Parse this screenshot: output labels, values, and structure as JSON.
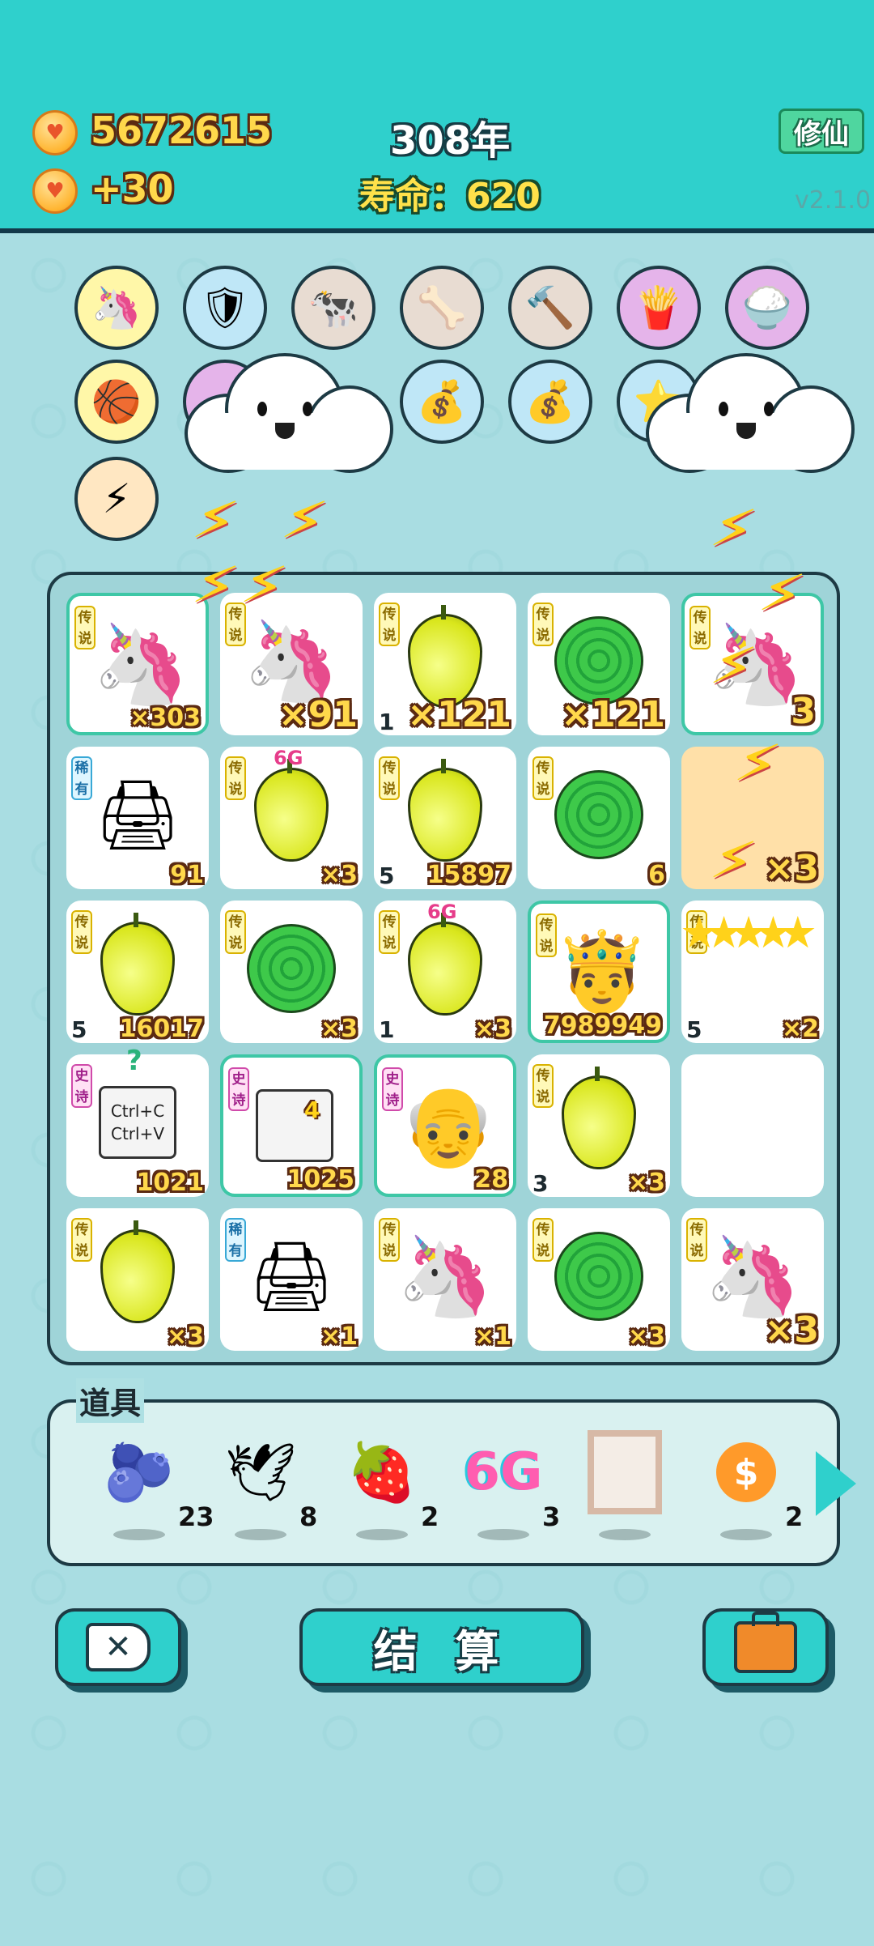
{
  "header": {
    "coins": "5672615",
    "income": "+30",
    "year": "308年",
    "lifespan_label": "寿命：",
    "lifespan_value": "620",
    "xiuxian_button": "修仙",
    "version": "v2.1.0"
  },
  "round_items": [
    {
      "name": "unicorn-icon",
      "glyph": "🦄",
      "bg": "#fff7a8"
    },
    {
      "name": "shield-wrench-icon",
      "glyph": "🛡",
      "bg": "#bfe7f7"
    },
    {
      "name": "cow-pair-icon",
      "glyph": "🐄",
      "bg": "#e8dcd2"
    },
    {
      "name": "pet-bowl-icon",
      "glyph": "🦴",
      "bg": "#e8dcd2"
    },
    {
      "name": "hammer-icon",
      "glyph": "🔨",
      "bg": "#e8dcd2"
    },
    {
      "name": "fries-icon",
      "glyph": "🍟",
      "bg": "#e5b4ea"
    },
    {
      "name": "rice-bowl-icon",
      "glyph": "🍚",
      "bg": "#e5b4ea"
    },
    {
      "name": "basketballs-icon",
      "glyph": "🏀",
      "bg": "#fff7a8"
    },
    {
      "name": "hidden-item-icon",
      "glyph": "",
      "bg": "#e5b4ea"
    },
    {
      "name": "money-bag-icon",
      "glyph": "💰",
      "bg": "#bfe7f7"
    },
    {
      "name": "money-bag-icon",
      "glyph": "💰",
      "bg": "#bfe7f7"
    },
    {
      "name": "star-wand-icon",
      "glyph": "⭐",
      "bg": "#bfe7f7"
    },
    {
      "name": "lightning-icon",
      "glyph": "⚡",
      "bg": "#ffe7c2"
    }
  ],
  "grid": [
    {
      "badge": "传说",
      "type": "legend",
      "icon": "unicorn",
      "count": "×303",
      "big": false,
      "hl": true
    },
    {
      "badge": "传说",
      "type": "legend",
      "icon": "unicorn",
      "count": "×91",
      "big": true
    },
    {
      "badge": "传说",
      "type": "legend",
      "icon": "pear",
      "count": "×121",
      "big": true,
      "lvl": "1"
    },
    {
      "badge": "传说",
      "type": "legend",
      "icon": "melon",
      "count": "×121",
      "big": true
    },
    {
      "badge": "传说",
      "type": "legend",
      "icon": "unicorn",
      "count": "3",
      "big": true,
      "hl": true
    },
    {
      "badge": "稀有",
      "type": "rare",
      "icon": "printer",
      "count": "91"
    },
    {
      "badge": "传说",
      "type": "legend",
      "icon": "pear",
      "count": "×3",
      "sixg": "6G"
    },
    {
      "badge": "传说",
      "type": "legend",
      "icon": "pear",
      "count": "15897",
      "lvl": "5"
    },
    {
      "badge": "传说",
      "type": "legend",
      "icon": "melon",
      "count": "6"
    },
    {
      "badge": "",
      "type": "",
      "icon": "",
      "count": "×3",
      "big": true,
      "orange": true
    },
    {
      "badge": "传说",
      "type": "legend",
      "icon": "pear",
      "count": "16017",
      "lvl": "5"
    },
    {
      "badge": "传说",
      "type": "legend",
      "icon": "melon",
      "count": "×3"
    },
    {
      "badge": "传说",
      "type": "legend",
      "icon": "pear",
      "count": "×3",
      "lvl": "1",
      "sixg": "6G"
    },
    {
      "badge": "传说",
      "type": "legend",
      "icon": "king",
      "count": "7989949",
      "hl": true
    },
    {
      "badge": "传说",
      "type": "legend",
      "icon": "",
      "count": "×2",
      "lvl": "5"
    },
    {
      "badge": "史诗",
      "type": "epic",
      "icon": "copy",
      "count": "1021",
      "question": "?",
      "copy_text": "Ctrl+C\nCtrl+V"
    },
    {
      "badge": "史诗",
      "type": "epic",
      "icon": "copy",
      "count": "1025",
      "hl": true,
      "boost": "4"
    },
    {
      "badge": "史诗",
      "type": "epic",
      "icon": "oldman",
      "count": "28",
      "hl": true
    },
    {
      "badge": "传说",
      "type": "legend",
      "icon": "pear",
      "count": "×3",
      "lvl": "3"
    },
    {
      "badge": "",
      "type": "",
      "icon": "",
      "count": ""
    },
    {
      "badge": "传说",
      "type": "legend",
      "icon": "pear",
      "count": "×3"
    },
    {
      "badge": "稀有",
      "type": "rare",
      "icon": "printer",
      "count": "×1"
    },
    {
      "badge": "传说",
      "type": "legend",
      "icon": "unicorn",
      "count": "×1"
    },
    {
      "badge": "传说",
      "type": "legend",
      "icon": "melon",
      "count": "×3"
    },
    {
      "badge": "传说",
      "type": "legend",
      "icon": "unicorn",
      "count": "×3",
      "big": true
    }
  ],
  "tools": {
    "title": "道具",
    "items": [
      {
        "name": "blueberry-icon",
        "glyph": "🫐",
        "count": "23"
      },
      {
        "name": "dove-icon",
        "glyph": "🕊",
        "count": "8"
      },
      {
        "name": "strawberry-icon",
        "glyph": "🍓",
        "count": "2"
      },
      {
        "name": "6g-icon",
        "glyph": "6G",
        "count": "3"
      },
      {
        "name": "frame-icon",
        "glyph": "▢",
        "count": ""
      },
      {
        "name": "dollar-coin-icon",
        "glyph": "$",
        "count": "2"
      }
    ]
  },
  "buttons": {
    "settle": "结 算"
  },
  "colors": {
    "accent": "#2fd0cc",
    "dark": "#1d3a44",
    "gold": "#ffd84b"
  }
}
